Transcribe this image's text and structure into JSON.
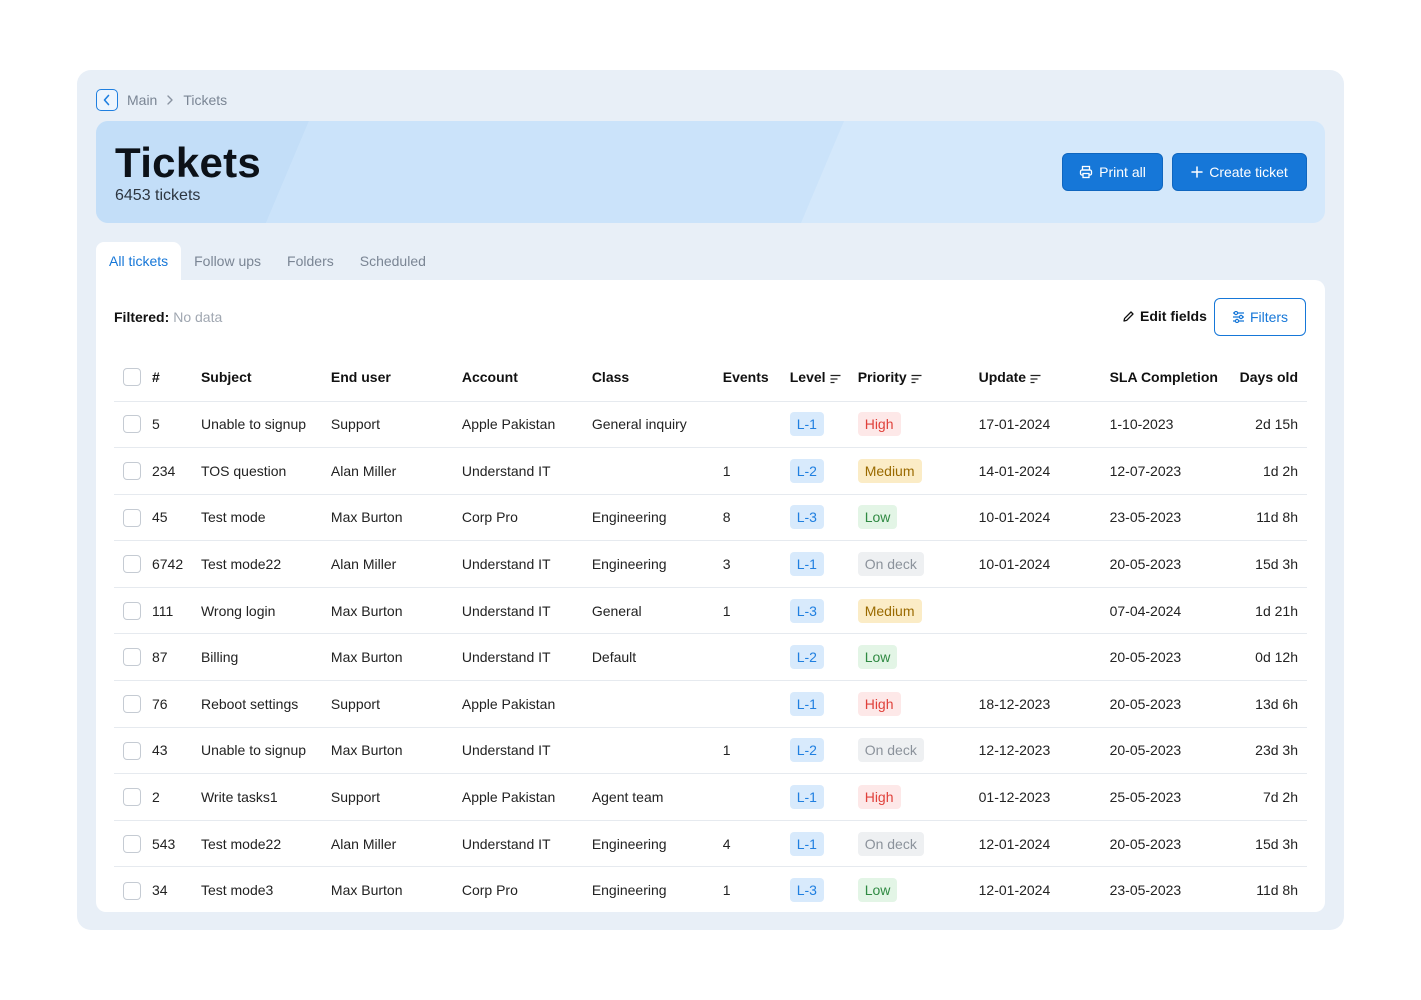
{
  "breadcrumb": {
    "items": [
      "Main",
      "Tickets"
    ]
  },
  "header": {
    "title": "Tickets",
    "count": "6453 tickets",
    "print_label": "Print all",
    "create_label": "Create ticket"
  },
  "tabs": [
    "All tickets",
    "Follow ups",
    "Folders",
    "Scheduled"
  ],
  "toolbar": {
    "filtered_label": "Filtered:",
    "filtered_value": "No data",
    "edit_fields_label": "Edit fields",
    "filters_label": "Filters"
  },
  "table": {
    "headers": [
      "#",
      "Subject",
      "End user",
      "Account",
      "Class",
      "Events",
      "Level",
      "Priority",
      "Update",
      "SLA Completion",
      "Days old"
    ],
    "rows": [
      [
        "5",
        "Unable to signup",
        "Support",
        "Apple Pakistan",
        "General inquiry",
        "",
        "L-1",
        "High",
        "17-01-2024",
        "1-10-2023",
        "2d 15h"
      ],
      [
        "234",
        "TOS question",
        "Alan Miller",
        "Understand IT",
        "",
        "1",
        "L-2",
        "Medium",
        "14-01-2024",
        "12-07-2023",
        "1d 2h"
      ],
      [
        "45",
        "Test mode",
        "Max Burton",
        "Corp Pro",
        "Engineering",
        "8",
        "L-3",
        "Low",
        "10-01-2024",
        "23-05-2023",
        "11d 8h"
      ],
      [
        "6742",
        "Test mode22",
        "Alan Miller",
        "Understand IT",
        "Engineering",
        "3",
        "L-1",
        "On deck",
        "10-01-2024",
        "20-05-2023",
        "15d 3h"
      ],
      [
        "111",
        "Wrong login",
        "Max Burton",
        "Understand IT",
        "General",
        "1",
        "L-3",
        "Medium",
        "",
        "07-04-2024",
        "1d 21h"
      ],
      [
        "87",
        "Billing",
        "Max Burton",
        "Understand IT",
        "Default",
        "",
        "L-2",
        "Low",
        "",
        "20-05-2023",
        "0d 12h"
      ],
      [
        "76",
        "Reboot settings",
        "Support",
        "Apple Pakistan",
        "",
        "",
        "L-1",
        "High",
        "18-12-2023",
        "20-05-2023",
        "13d 6h"
      ],
      [
        "43",
        "Unable to signup",
        "Max Burton",
        "Understand IT",
        "",
        "1",
        "L-2",
        "On deck",
        "12-12-2023",
        "20-05-2023",
        "23d 3h"
      ],
      [
        "2",
        "Write tasks1",
        "Support",
        "Apple Pakistan",
        "Agent team",
        "",
        "L-1",
        "High",
        "01-12-2023",
        "25-05-2023",
        "7d 2h"
      ],
      [
        "543",
        "Test mode22",
        "Alan Miller",
        "Understand IT",
        "Engineering",
        "4",
        "L-1",
        "On deck",
        "12-01-2024",
        "20-05-2023",
        "15d 3h"
      ],
      [
        "34",
        "Test mode3",
        "Max Burton",
        "Corp Pro",
        "Engineering",
        "1",
        "L-3",
        "Low",
        "12-01-2024",
        "23-05-2023",
        "11d 8h"
      ]
    ]
  },
  "colors": {
    "accent": "#1677d8",
    "frame_bg": "#e8eff7",
    "hero_bg": "#d4e8fb",
    "priority_high": "#e0413b",
    "priority_medium": "#9a6a00",
    "priority_low": "#2f8a42",
    "priority_on_deck": "#8b929b"
  },
  "icons": {
    "back": "chevron-left-icon",
    "separator": "chevron-right-icon",
    "print": "printer-icon",
    "create": "plus-icon",
    "edit": "pencil-icon",
    "filters": "sliders-icon",
    "sort": "sort-lines-icon"
  }
}
